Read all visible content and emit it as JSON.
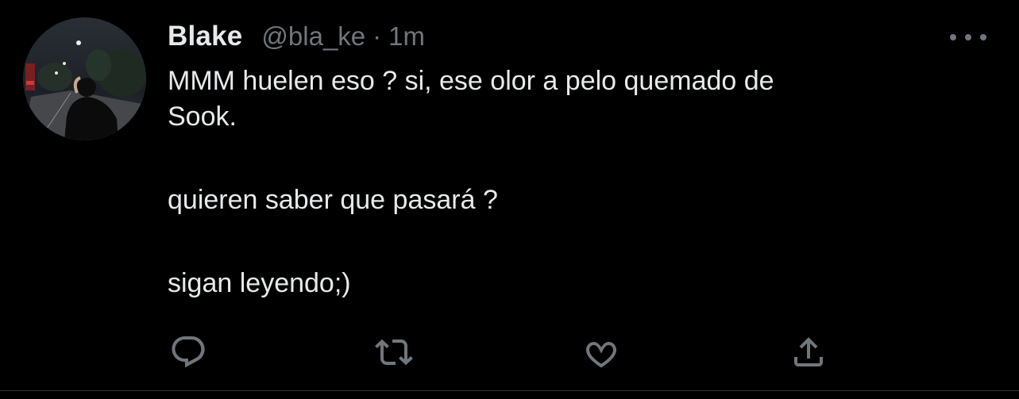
{
  "tweet": {
    "author": {
      "display_name": "Blake",
      "handle": "@bla_ke"
    },
    "separator": "·",
    "timestamp": "1m",
    "body": {
      "line1": "MMM huelen eso ? si, ese olor a pelo quemado de",
      "line2": "Sook.",
      "line3": "quieren saber que pasará ?",
      "line4": "sigan leyendo;)"
    }
  },
  "actions": {
    "icons": [
      "reply-icon",
      "retweet-icon",
      "like-icon",
      "share-icon"
    ]
  },
  "colors": {
    "background": "#000000",
    "text_primary": "#e7e9ea",
    "text_secondary": "#71767b",
    "divider": "#2f3336"
  }
}
